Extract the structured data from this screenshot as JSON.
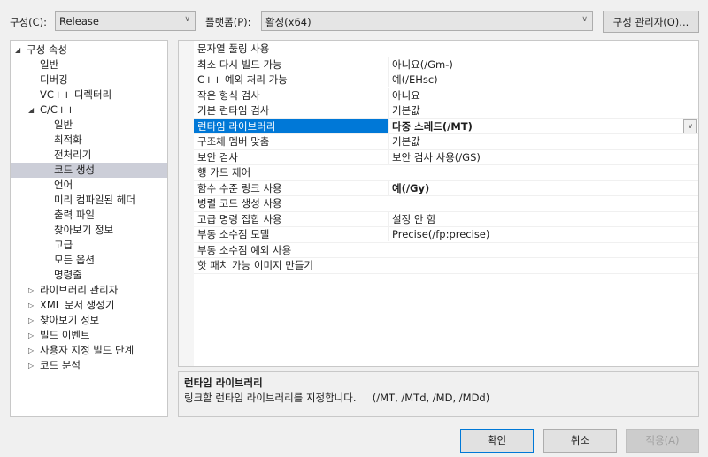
{
  "toolbar": {
    "config_label": "구성(C):",
    "config_value": "Release",
    "platform_label": "플랫폼(P):",
    "platform_value": "활성(x64)",
    "config_manager": "구성 관리자(O)..."
  },
  "tree": [
    {
      "label": "구성 속성",
      "level": 0,
      "expand": "open"
    },
    {
      "label": "일반",
      "level": 1
    },
    {
      "label": "디버깅",
      "level": 1
    },
    {
      "label": "VC++ 디렉터리",
      "level": 1
    },
    {
      "label": "C/C++",
      "level": 1,
      "expand": "open"
    },
    {
      "label": "일반",
      "level": 2
    },
    {
      "label": "최적화",
      "level": 2
    },
    {
      "label": "전처리기",
      "level": 2
    },
    {
      "label": "코드 생성",
      "level": 2,
      "selected": true
    },
    {
      "label": "언어",
      "level": 2
    },
    {
      "label": "미리 컴파일된 헤더",
      "level": 2
    },
    {
      "label": "출력 파일",
      "level": 2
    },
    {
      "label": "찾아보기 정보",
      "level": 2
    },
    {
      "label": "고급",
      "level": 2
    },
    {
      "label": "모든 옵션",
      "level": 2
    },
    {
      "label": "명령줄",
      "level": 2
    },
    {
      "label": "라이브러리 관리자",
      "level": 1,
      "expand": "closed"
    },
    {
      "label": "XML 문서 생성기",
      "level": 1,
      "expand": "closed"
    },
    {
      "label": "찾아보기 정보",
      "level": 1,
      "expand": "closed"
    },
    {
      "label": "빌드 이벤트",
      "level": 1,
      "expand": "closed"
    },
    {
      "label": "사용자 지정 빌드 단계",
      "level": 1,
      "expand": "closed"
    },
    {
      "label": "코드 분석",
      "level": 1,
      "expand": "closed"
    }
  ],
  "properties": [
    {
      "name": "문자열 풀링 사용",
      "value": ""
    },
    {
      "name": "최소 다시 빌드 가능",
      "value": "아니요(/Gm-)"
    },
    {
      "name": "C++ 예외 처리 가능",
      "value": "예(/EHsc)"
    },
    {
      "name": "작은 형식 검사",
      "value": "아니요"
    },
    {
      "name": "기본 런타임 검사",
      "value": "기본값"
    },
    {
      "name": "런타임 라이브러리",
      "value": "다중 스레드(/MT)",
      "bold": true,
      "selected": true
    },
    {
      "name": "구조체 멤버 맞춤",
      "value": "기본값"
    },
    {
      "name": "보안 검사",
      "value": "보안 검사 사용(/GS)"
    },
    {
      "name": "행 가드 제어",
      "value": ""
    },
    {
      "name": "함수 수준 링크 사용",
      "value": "예(/Gy)",
      "bold": true
    },
    {
      "name": "병렬 코드 생성 사용",
      "value": ""
    },
    {
      "name": "고급 명령 집합 사용",
      "value": "설정 안 함"
    },
    {
      "name": "부동 소수점 모델",
      "value": "Precise(/fp:precise)"
    },
    {
      "name": "부동 소수점 예외 사용",
      "value": ""
    },
    {
      "name": "핫 패치 가능 이미지 만들기",
      "value": ""
    }
  ],
  "description": {
    "title": "런타임 라이브러리",
    "text": "링크할 런타임 라이브러리를 지정합니다.     (/MT, /MTd, /MD, /MDd)"
  },
  "buttons": {
    "ok": "확인",
    "cancel": "취소",
    "apply": "적용(A)"
  }
}
